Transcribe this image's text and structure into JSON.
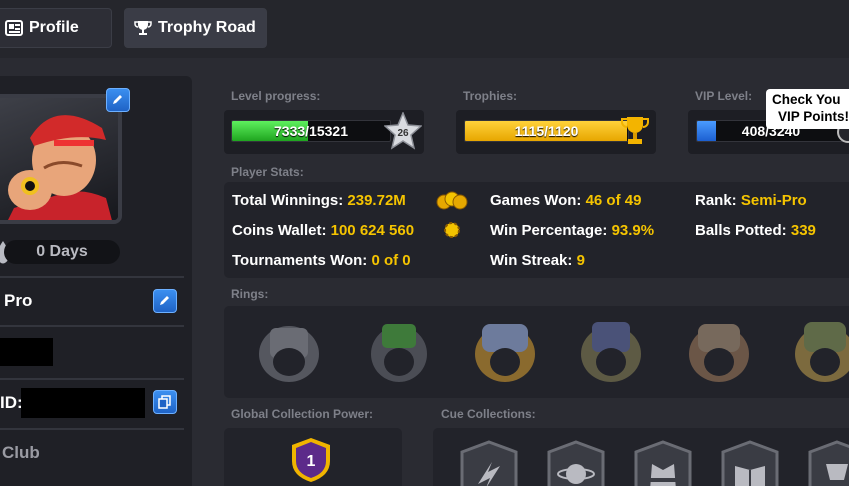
{
  "tabs": [
    {
      "label": "Profile",
      "icon": "profile-card-icon",
      "active": false
    },
    {
      "label": "Trophy Road",
      "icon": "trophy-icon",
      "active": true
    }
  ],
  "profile": {
    "days_label": "0 Days",
    "rank_name": "Pro",
    "id_label": "ID:",
    "club_label": "Club"
  },
  "level_progress": {
    "label": "Level progress:",
    "text": "7333/15321",
    "current": 7333,
    "max": 15321,
    "level": "26"
  },
  "trophies": {
    "label": "Trophies:",
    "text": "1115/1120",
    "current": 1115,
    "max": 1120
  },
  "vip": {
    "label": "VIP Level:",
    "text": "408/3240",
    "current": 408,
    "max": 3240,
    "tooltip_line1": "Check You",
    "tooltip_line2": "VIP Points!"
  },
  "player_stats": {
    "label": "Player Stats:",
    "total_winnings_label": "Total Winnings:",
    "total_winnings": "239.72M",
    "coins_wallet_label": "Coins Wallet:",
    "coins_wallet": "100 624 560",
    "tournaments_won_label": "Tournaments Won:",
    "tournaments_won": "0 of 0",
    "games_won_label": "Games Won:",
    "games_won": "46 of 49",
    "win_percentage_label": "Win Percentage:",
    "win_percentage": "93.9%",
    "win_streak_label": "Win Streak:",
    "win_streak": "9",
    "rank_label": "Rank:",
    "rank": "Semi-Pro",
    "balls_potted_label": "Balls Potted:",
    "balls_potted": "339"
  },
  "rings": {
    "label": "Rings:",
    "count": 6
  },
  "global_collection": {
    "label": "Global Collection Power:",
    "level": "1"
  },
  "cue_collections": {
    "label": "Cue Collections:"
  },
  "colors": {
    "green": "#3dd63d",
    "gold": "#f5c400",
    "blue": "#2e7fe6",
    "value_yellow": "#f5c400"
  }
}
